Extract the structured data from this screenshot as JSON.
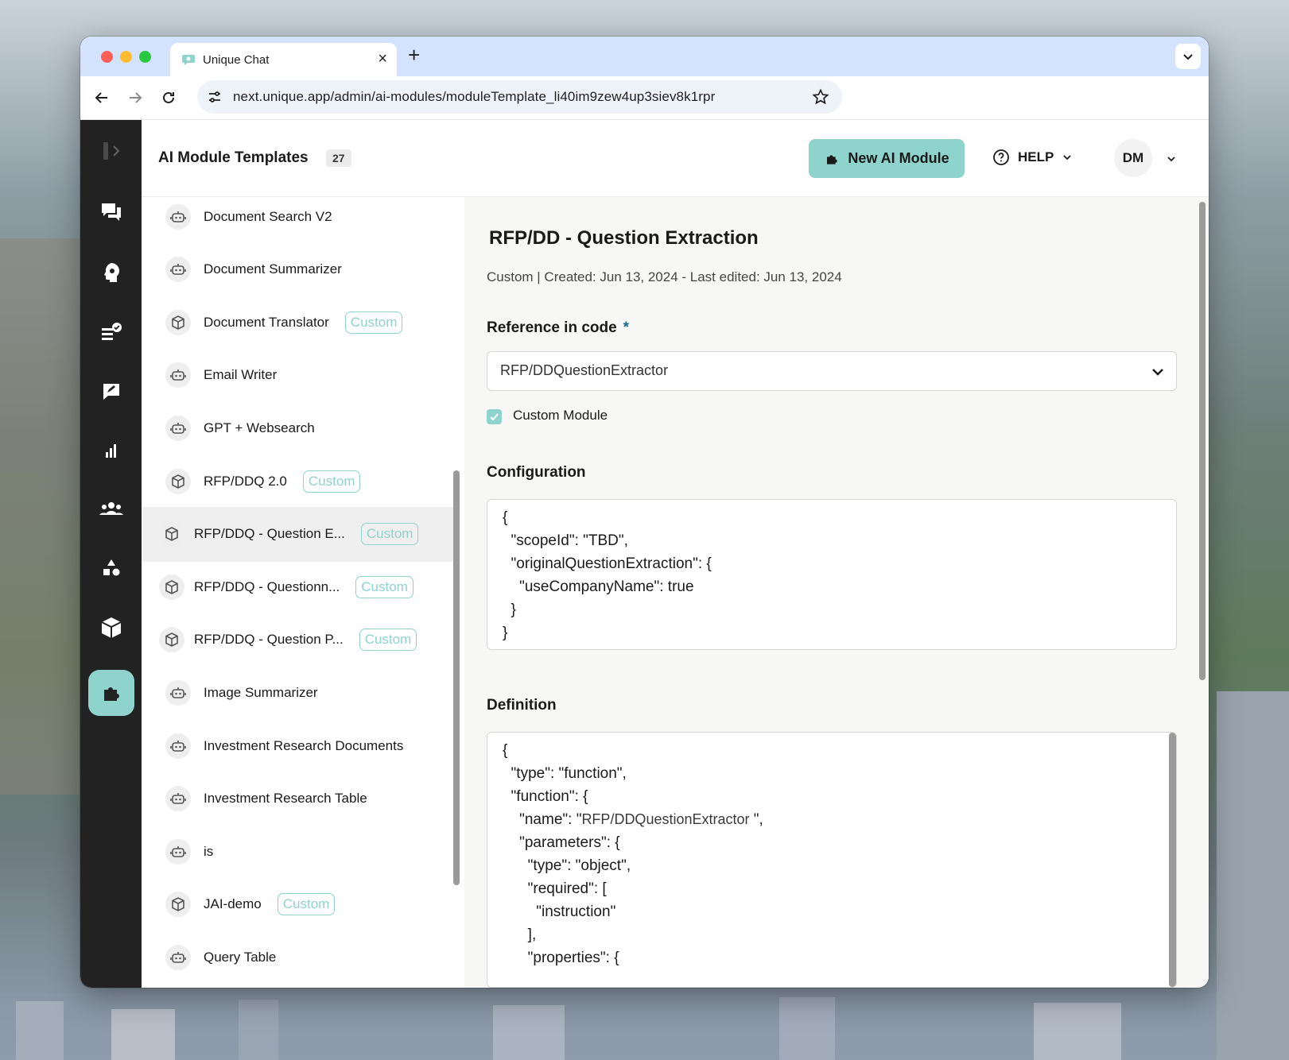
{
  "browser": {
    "tab_title": "Unique Chat",
    "url": "next.unique.app/admin/ai-modules/moduleTemplate_li40im9zew4up3siev8k1rpr"
  },
  "header": {
    "title": "AI Module Templates",
    "count": "27",
    "new_button": "New AI Module",
    "help_label": "HELP",
    "avatar_initials": "DM"
  },
  "list": {
    "items": [
      {
        "label": "Document Search V2"
      },
      {
        "label": "Document Summarizer"
      },
      {
        "label": "Document Translator",
        "tag": "Custom"
      },
      {
        "label": "Email Writer"
      },
      {
        "label": "GPT + Websearch"
      },
      {
        "label": "RFP/DDQ 2.0",
        "tag": "Custom"
      },
      {
        "label": "RFP/DDQ - Question E...",
        "tag": "Custom"
      },
      {
        "label": "RFP/DDQ  - Questionn...",
        "tag": "Custom"
      },
      {
        "label": "RFP/DDQ - Question P...",
        "tag": "Custom"
      },
      {
        "label": "Image Summarizer"
      },
      {
        "label": "Investment Research Documents"
      },
      {
        "label": "Investment Research Table"
      },
      {
        "label": "is"
      },
      {
        "label": "JAI-demo",
        "tag": "Custom"
      },
      {
        "label": "Query Table"
      }
    ]
  },
  "detail": {
    "title": "RFP/DD  - Question Extraction",
    "meta": "Custom | Created: Jun 13, 2024 - Last edited: Jun 13, 2024",
    "reference_label": "Reference in code",
    "required_marker": "*",
    "reference_value": "RFP/DDQuestionExtractor",
    "custom_module_label": "Custom Module",
    "configuration_label": "Configuration",
    "configuration_lines": [
      "{",
      "  \"scopeId\": \"TBD\",",
      "  \"originalQuestionExtraction\": {",
      "    \"useCompanyName\": true",
      "  }",
      "}"
    ],
    "definition_label": "Definition",
    "definition_lines": [
      "{",
      "  \"type\": \"function\",",
      "  \"function\": {",
      "    \"name\": \"",
      "    \"parameters\": {",
      "      \"type\": \"object\",",
      "      \"required\": [",
      "        \"instruction\"",
      "      ],",
      "      \"properties\": {"
    ],
    "definition_name_value": "RFP/DDQuestionExtractor",
    "definition_name_suffix": " \","
  },
  "colors": {
    "accent": "#8fd3cd",
    "rail": "#222222",
    "tab_strip": "#d3e3fd"
  },
  "icons": {
    "rail": [
      "sidebar-toggle-icon",
      "chat-icon",
      "brain-gear-icon",
      "list-check-icon",
      "message-edit-icon",
      "bar-chart-icon",
      "users-icon",
      "shapes-icon",
      "cube-icon",
      "puzzle-icon"
    ]
  }
}
